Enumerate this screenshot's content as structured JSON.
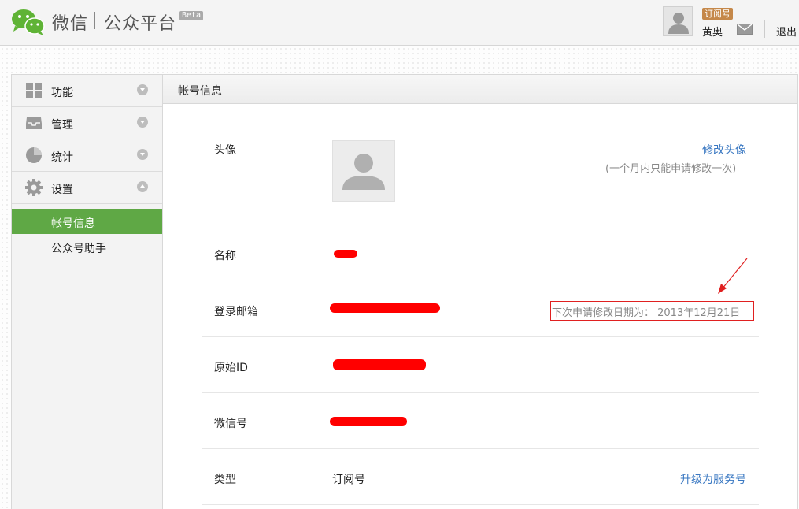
{
  "header": {
    "logo_main": "微信",
    "logo_sub": "公众平台",
    "beta": "Beta",
    "account_type_badge": "订阅号",
    "user_name": "黄奥",
    "logout": "退出"
  },
  "sidebar": {
    "menus": [
      {
        "label": "功能",
        "icon": "grid-icon",
        "expanded": false
      },
      {
        "label": "管理",
        "icon": "inbox-icon",
        "expanded": false
      },
      {
        "label": "统计",
        "icon": "pie-chart-icon",
        "expanded": false
      },
      {
        "label": "设置",
        "icon": "gear-icon",
        "expanded": true
      }
    ],
    "submenu": [
      {
        "label": "帐号信息",
        "active": true
      },
      {
        "label": "公众号助手",
        "active": false
      }
    ]
  },
  "panel": {
    "title": "帐号信息",
    "avatar": {
      "label": "头像",
      "change_link": "修改头像",
      "hint": "(一个月内只能申请修改一次)"
    },
    "name": {
      "label": "名称"
    },
    "email": {
      "label": "登录邮箱",
      "notice": "下次申请修改日期为： 2013年12月21日"
    },
    "original_id": {
      "label": "原始ID"
    },
    "wechat_id": {
      "label": "微信号"
    },
    "type": {
      "label": "类型",
      "value": "订阅号",
      "upgrade_link": "升级为服务号"
    }
  },
  "colors": {
    "accent_green": "#5fa845",
    "link_blue": "#3a78c2",
    "redaction_red": "#ff0000",
    "badge_orange": "#c5884a"
  }
}
